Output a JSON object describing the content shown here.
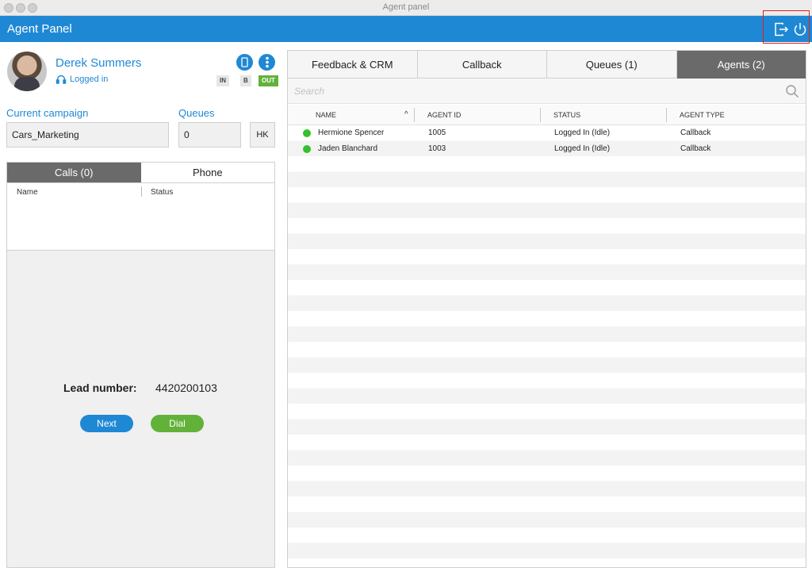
{
  "window": {
    "title": "Agent panel"
  },
  "header": {
    "title": "Agent Panel",
    "icons": [
      "logout-icon",
      "power-icon"
    ],
    "accent": "#1f88d4",
    "highlight_color": "#e02020"
  },
  "agent": {
    "name": "Derek Summers",
    "status": "Logged in",
    "modes": [
      "IN",
      "B",
      "OUT"
    ],
    "active_mode": "OUT"
  },
  "campaign": {
    "label": "Current campaign",
    "value": "Cars_Marketing"
  },
  "queues": {
    "label": "Queues",
    "value": "0",
    "hk_label": "HK"
  },
  "left_tabs": {
    "calls": "Calls (0)",
    "phone": "Phone"
  },
  "calls_table": {
    "columns": [
      "Name",
      "Status"
    ]
  },
  "lead": {
    "label": "Lead number:",
    "value": "4420200103",
    "next_label": "Next",
    "dial_label": "Dial"
  },
  "right_tabs": [
    "Feedback & CRM",
    "Callback",
    "Queues (1)",
    "Agents (2)"
  ],
  "search": {
    "placeholder": "Search"
  },
  "agents_table": {
    "columns": [
      "NAME",
      "AGENT ID",
      "STATUS",
      "AGENT TYPE"
    ],
    "rows": [
      {
        "name": "Hermione Spencer",
        "agent_id": "1005",
        "status": "Logged In (Idle)",
        "type": "Callback"
      },
      {
        "name": "Jaden Blanchard",
        "agent_id": "1003",
        "status": "Logged In (Idle)",
        "type": "Callback"
      }
    ]
  }
}
